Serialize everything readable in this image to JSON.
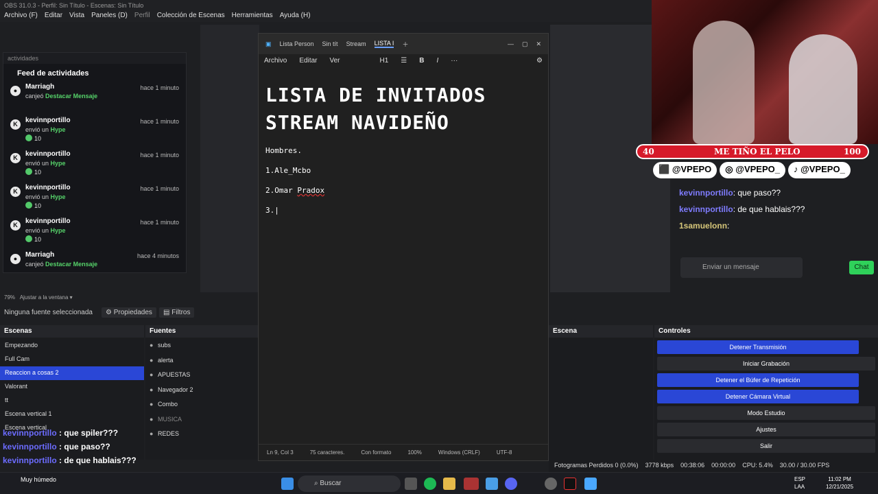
{
  "obs": {
    "title": "OBS 31.0.3 - Perfil: Sin Título - Escenas: Sin Título",
    "menu": [
      "Archivo (F)",
      "Editar",
      "Vista",
      "Paneles (D)",
      "Perfil",
      "Colección de Escenas",
      "Herramientas",
      "Ayuda (H)"
    ],
    "zoom": "79%",
    "zoom_mode": "Ajustar a la ventana",
    "no_source": "Ninguna fuente seleccionada",
    "props_button": "Propiedades",
    "filters_button": "Filtros",
    "scenes_title": "Escenas",
    "sources_title": "Fuentes",
    "transitions_title": "Escena",
    "controls_title": "Controles",
    "scenes": [
      "Empezando",
      "Full Cam",
      "Reaccion a cosas 2",
      "Valorant",
      "tt",
      "Escena vertical 1",
      "Escena vertical"
    ],
    "selected_scene": "Reaccion a cosas 2",
    "sources": [
      "subs",
      "alerta",
      "APUESTAS",
      "Navegador 2",
      "Combo",
      "MUSICA",
      "REDES"
    ],
    "controls": [
      "Detener Transmisión",
      "Iniciar Grabación",
      "Detener el Búfer de Repetición",
      "Detener Cámara Virtual",
      "Modo Estudio",
      "Ajustes",
      "Salir"
    ],
    "status": {
      "dropped": "Fotogramas Perdidos 0 (0.0%)",
      "bitrate": "3778 kbps",
      "live_time": "00:38:06",
      "rec_time": "00:00:00",
      "cpu": "CPU: 5.4%",
      "fps": "30.00 / 30.00 FPS"
    }
  },
  "activity": {
    "panel_label": "actividades",
    "title": "Feed de actividades",
    "items": [
      {
        "name": "Marriagh",
        "time": "hace 1 minuto",
        "action": "canjeó",
        "highlight": "Destacar Mensaje",
        "amount": ""
      },
      {
        "name": "kevinnportillo",
        "time": "hace 1 minuto",
        "action": "envió un",
        "highlight": "Hype",
        "amount": "10"
      },
      {
        "name": "kevinnportillo",
        "time": "hace 1 minuto",
        "action": "envió un",
        "highlight": "Hype",
        "amount": "10"
      },
      {
        "name": "kevinnportillo",
        "time": "hace 1 minuto",
        "action": "envió un",
        "highlight": "Hype",
        "amount": "10"
      },
      {
        "name": "kevinnportillo",
        "time": "hace 1 minuto",
        "action": "envió un",
        "highlight": "Hype",
        "amount": "10"
      },
      {
        "name": "Marriagh",
        "time": "hace 4 minutos",
        "action": "canjeó",
        "highlight": "Destacar Mensaje",
        "amount": ""
      }
    ]
  },
  "notepad": {
    "tabs": [
      "Lista Person",
      "Sin tít",
      "Stream",
      "LISTA I"
    ],
    "menu": [
      "Archivo",
      "Editar",
      "Ver"
    ],
    "heading_style": "H1",
    "title_line1": "LISTA DE INVITADOS",
    "title_line2": "STREAM NAVIDEÑO",
    "line_hombres": "Hombres.",
    "line1": "1.Ale_Mcbo",
    "line2_prefix": "2.Omar ",
    "line2_err": "Pradox",
    "line3": "3.",
    "status": {
      "pos": "Ln 9, Col 3",
      "chars": "75 caracteres.",
      "format": "Con formato",
      "zoom": "100%",
      "eol": "Windows (CRLF)",
      "enc": "UTF-8"
    }
  },
  "stream_overlay": {
    "poll_left": "40",
    "poll_title": "ME TIÑO EL PELO",
    "poll_right": "100",
    "socials": [
      "@VPEPO",
      "@VPEPO_",
      "@VPEPO_"
    ],
    "chat": [
      {
        "user": "kevinnportillo",
        "msg": "que paso??"
      },
      {
        "user": "kevinnportillo",
        "msg": "de que hablais???"
      },
      {
        "user": "1samuelonn",
        "msg": ""
      }
    ],
    "chat_placeholder": "Enviar un mensaje",
    "chat_button": "Chat"
  },
  "chat_overlay": [
    {
      "user": "kevinnportillo",
      "msg": ": que spiler???"
    },
    {
      "user": "kevinnportillo",
      "msg": ": que paso??"
    },
    {
      "user": "kevinnportillo",
      "msg": ": de que hablais???"
    },
    {
      "user": "1samuelonn",
      "msg": ""
    }
  ],
  "taskbar": {
    "weather": "Muy húmedo",
    "search": "Buscar",
    "lang1": "ESP",
    "lang2": "LAA",
    "time": "11:02 PM",
    "date": "12/21/2025"
  }
}
